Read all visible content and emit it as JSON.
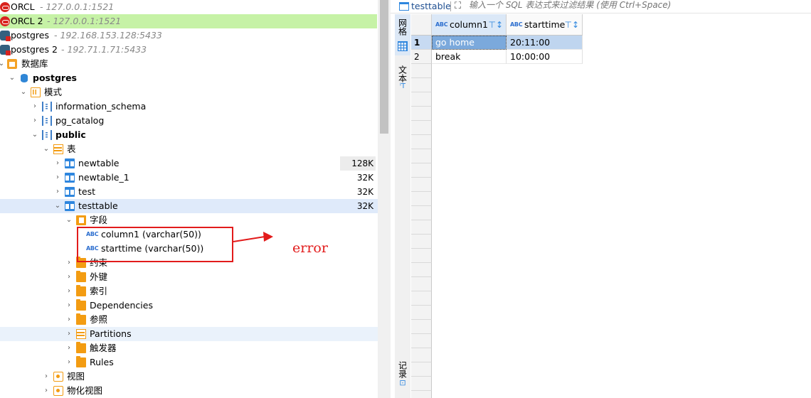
{
  "navigator": {
    "rows": [
      {
        "label": "ORCL",
        "sub": "- 127.0.0.1:1521",
        "icon": "oracle-connection-icon"
      },
      {
        "label": "ORCL 2",
        "sub": "- 127.0.0.1:1521",
        "icon": "oracle-connection-icon"
      },
      {
        "label": "postgres",
        "sub": "- 192.168.153.128:5433",
        "icon": "postgres-connection-icon"
      },
      {
        "label": "postgres 2",
        "sub": "- 192.71.1.71:5433",
        "icon": "postgres-connection-icon"
      },
      {
        "label": "数据库",
        "icon": "databases-folder-icon"
      },
      {
        "label": "postgres",
        "icon": "database-icon"
      },
      {
        "label": "模式",
        "icon": "schemas-folder-icon"
      },
      {
        "label": "information_schema",
        "icon": "schema-icon"
      },
      {
        "label": "pg_catalog",
        "icon": "schema-icon"
      },
      {
        "label": "public",
        "icon": "schema-icon"
      },
      {
        "label": "表",
        "icon": "tables-folder-icon"
      },
      {
        "label": "newtable",
        "size": "128K",
        "icon": "table-icon"
      },
      {
        "label": "newtable_1",
        "size": "32K",
        "icon": "table-icon"
      },
      {
        "label": "test",
        "size": "32K",
        "icon": "table-icon"
      },
      {
        "label": "testtable",
        "size": "32K",
        "icon": "table-icon"
      },
      {
        "label": "字段",
        "icon": "columns-folder-icon"
      },
      {
        "label": "column1 (varchar(50))",
        "type_glyph": "ABC",
        "icon": "string-column-icon"
      },
      {
        "label": "starttime (varchar(50))",
        "type_glyph": "ABC",
        "icon": "string-column-icon"
      },
      {
        "label": "约束",
        "icon": "folder-icon"
      },
      {
        "label": "外键",
        "icon": "folder-icon"
      },
      {
        "label": "索引",
        "icon": "folder-icon"
      },
      {
        "label": "Dependencies",
        "icon": "folder-icon"
      },
      {
        "label": "参照",
        "icon": "folder-icon"
      },
      {
        "label": "Partitions",
        "icon": "partitions-icon"
      },
      {
        "label": "触发器",
        "icon": "folder-icon"
      },
      {
        "label": "Rules",
        "icon": "folder-icon"
      },
      {
        "label": "视图",
        "icon": "views-folder-icon"
      },
      {
        "label": "物化视图",
        "icon": "views-folder-icon"
      }
    ]
  },
  "annotation": {
    "text": "error",
    "color": "#e21b1b"
  },
  "results": {
    "table_name": "testtable",
    "filter_placeholder": "输入一个 SQL 表达式来过滤结果 (使用 Ctrl+Space)",
    "side_tabs": {
      "grid": "网格",
      "text": "文本",
      "record": "记录"
    },
    "columns": [
      {
        "name": "column1",
        "type_glyph": "ABC"
      },
      {
        "name": "starttime",
        "type_glyph": "ABC"
      }
    ],
    "rows": [
      {
        "num": "1",
        "column1": "go home",
        "starttime": "20:11:00"
      },
      {
        "num": "2",
        "column1": "break",
        "starttime": "10:00:00"
      }
    ]
  },
  "colors": {
    "selection": "#7ba9dc",
    "highlight_row": "#c6f2a6",
    "accent": "#2e86de"
  }
}
